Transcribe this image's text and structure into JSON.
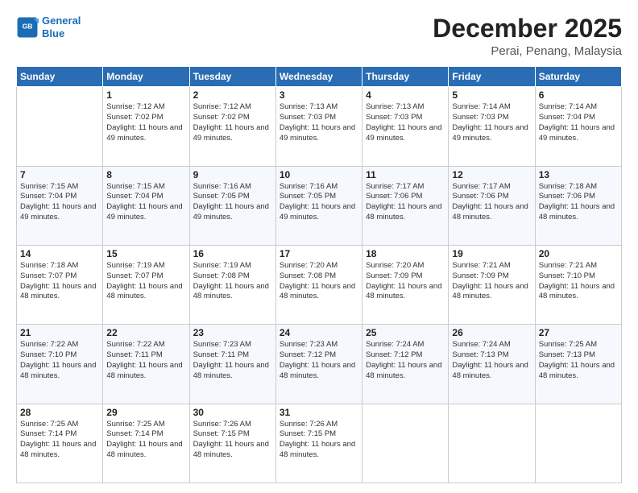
{
  "header": {
    "logo_line1": "General",
    "logo_line2": "Blue",
    "title": "December 2025",
    "subtitle": "Perai, Penang, Malaysia"
  },
  "weekdays": [
    "Sunday",
    "Monday",
    "Tuesday",
    "Wednesday",
    "Thursday",
    "Friday",
    "Saturday"
  ],
  "weeks": [
    [
      {
        "day": "",
        "sunrise": "",
        "sunset": "",
        "daylight": ""
      },
      {
        "day": "1",
        "sunrise": "Sunrise: 7:12 AM",
        "sunset": "Sunset: 7:02 PM",
        "daylight": "Daylight: 11 hours and 49 minutes."
      },
      {
        "day": "2",
        "sunrise": "Sunrise: 7:12 AM",
        "sunset": "Sunset: 7:02 PM",
        "daylight": "Daylight: 11 hours and 49 minutes."
      },
      {
        "day": "3",
        "sunrise": "Sunrise: 7:13 AM",
        "sunset": "Sunset: 7:03 PM",
        "daylight": "Daylight: 11 hours and 49 minutes."
      },
      {
        "day": "4",
        "sunrise": "Sunrise: 7:13 AM",
        "sunset": "Sunset: 7:03 PM",
        "daylight": "Daylight: 11 hours and 49 minutes."
      },
      {
        "day": "5",
        "sunrise": "Sunrise: 7:14 AM",
        "sunset": "Sunset: 7:03 PM",
        "daylight": "Daylight: 11 hours and 49 minutes."
      },
      {
        "day": "6",
        "sunrise": "Sunrise: 7:14 AM",
        "sunset": "Sunset: 7:04 PM",
        "daylight": "Daylight: 11 hours and 49 minutes."
      }
    ],
    [
      {
        "day": "7",
        "sunrise": "Sunrise: 7:15 AM",
        "sunset": "Sunset: 7:04 PM",
        "daylight": "Daylight: 11 hours and 49 minutes."
      },
      {
        "day": "8",
        "sunrise": "Sunrise: 7:15 AM",
        "sunset": "Sunset: 7:04 PM",
        "daylight": "Daylight: 11 hours and 49 minutes."
      },
      {
        "day": "9",
        "sunrise": "Sunrise: 7:16 AM",
        "sunset": "Sunset: 7:05 PM",
        "daylight": "Daylight: 11 hours and 49 minutes."
      },
      {
        "day": "10",
        "sunrise": "Sunrise: 7:16 AM",
        "sunset": "Sunset: 7:05 PM",
        "daylight": "Daylight: 11 hours and 49 minutes."
      },
      {
        "day": "11",
        "sunrise": "Sunrise: 7:17 AM",
        "sunset": "Sunset: 7:06 PM",
        "daylight": "Daylight: 11 hours and 48 minutes."
      },
      {
        "day": "12",
        "sunrise": "Sunrise: 7:17 AM",
        "sunset": "Sunset: 7:06 PM",
        "daylight": "Daylight: 11 hours and 48 minutes."
      },
      {
        "day": "13",
        "sunrise": "Sunrise: 7:18 AM",
        "sunset": "Sunset: 7:06 PM",
        "daylight": "Daylight: 11 hours and 48 minutes."
      }
    ],
    [
      {
        "day": "14",
        "sunrise": "Sunrise: 7:18 AM",
        "sunset": "Sunset: 7:07 PM",
        "daylight": "Daylight: 11 hours and 48 minutes."
      },
      {
        "day": "15",
        "sunrise": "Sunrise: 7:19 AM",
        "sunset": "Sunset: 7:07 PM",
        "daylight": "Daylight: 11 hours and 48 minutes."
      },
      {
        "day": "16",
        "sunrise": "Sunrise: 7:19 AM",
        "sunset": "Sunset: 7:08 PM",
        "daylight": "Daylight: 11 hours and 48 minutes."
      },
      {
        "day": "17",
        "sunrise": "Sunrise: 7:20 AM",
        "sunset": "Sunset: 7:08 PM",
        "daylight": "Daylight: 11 hours and 48 minutes."
      },
      {
        "day": "18",
        "sunrise": "Sunrise: 7:20 AM",
        "sunset": "Sunset: 7:09 PM",
        "daylight": "Daylight: 11 hours and 48 minutes."
      },
      {
        "day": "19",
        "sunrise": "Sunrise: 7:21 AM",
        "sunset": "Sunset: 7:09 PM",
        "daylight": "Daylight: 11 hours and 48 minutes."
      },
      {
        "day": "20",
        "sunrise": "Sunrise: 7:21 AM",
        "sunset": "Sunset: 7:10 PM",
        "daylight": "Daylight: 11 hours and 48 minutes."
      }
    ],
    [
      {
        "day": "21",
        "sunrise": "Sunrise: 7:22 AM",
        "sunset": "Sunset: 7:10 PM",
        "daylight": "Daylight: 11 hours and 48 minutes."
      },
      {
        "day": "22",
        "sunrise": "Sunrise: 7:22 AM",
        "sunset": "Sunset: 7:11 PM",
        "daylight": "Daylight: 11 hours and 48 minutes."
      },
      {
        "day": "23",
        "sunrise": "Sunrise: 7:23 AM",
        "sunset": "Sunset: 7:11 PM",
        "daylight": "Daylight: 11 hours and 48 minutes."
      },
      {
        "day": "24",
        "sunrise": "Sunrise: 7:23 AM",
        "sunset": "Sunset: 7:12 PM",
        "daylight": "Daylight: 11 hours and 48 minutes."
      },
      {
        "day": "25",
        "sunrise": "Sunrise: 7:24 AM",
        "sunset": "Sunset: 7:12 PM",
        "daylight": "Daylight: 11 hours and 48 minutes."
      },
      {
        "day": "26",
        "sunrise": "Sunrise: 7:24 AM",
        "sunset": "Sunset: 7:13 PM",
        "daylight": "Daylight: 11 hours and 48 minutes."
      },
      {
        "day": "27",
        "sunrise": "Sunrise: 7:25 AM",
        "sunset": "Sunset: 7:13 PM",
        "daylight": "Daylight: 11 hours and 48 minutes."
      }
    ],
    [
      {
        "day": "28",
        "sunrise": "Sunrise: 7:25 AM",
        "sunset": "Sunset: 7:14 PM",
        "daylight": "Daylight: 11 hours and 48 minutes."
      },
      {
        "day": "29",
        "sunrise": "Sunrise: 7:25 AM",
        "sunset": "Sunset: 7:14 PM",
        "daylight": "Daylight: 11 hours and 48 minutes."
      },
      {
        "day": "30",
        "sunrise": "Sunrise: 7:26 AM",
        "sunset": "Sunset: 7:15 PM",
        "daylight": "Daylight: 11 hours and 48 minutes."
      },
      {
        "day": "31",
        "sunrise": "Sunrise: 7:26 AM",
        "sunset": "Sunset: 7:15 PM",
        "daylight": "Daylight: 11 hours and 48 minutes."
      },
      {
        "day": "",
        "sunrise": "",
        "sunset": "",
        "daylight": ""
      },
      {
        "day": "",
        "sunrise": "",
        "sunset": "",
        "daylight": ""
      },
      {
        "day": "",
        "sunrise": "",
        "sunset": "",
        "daylight": ""
      }
    ]
  ]
}
